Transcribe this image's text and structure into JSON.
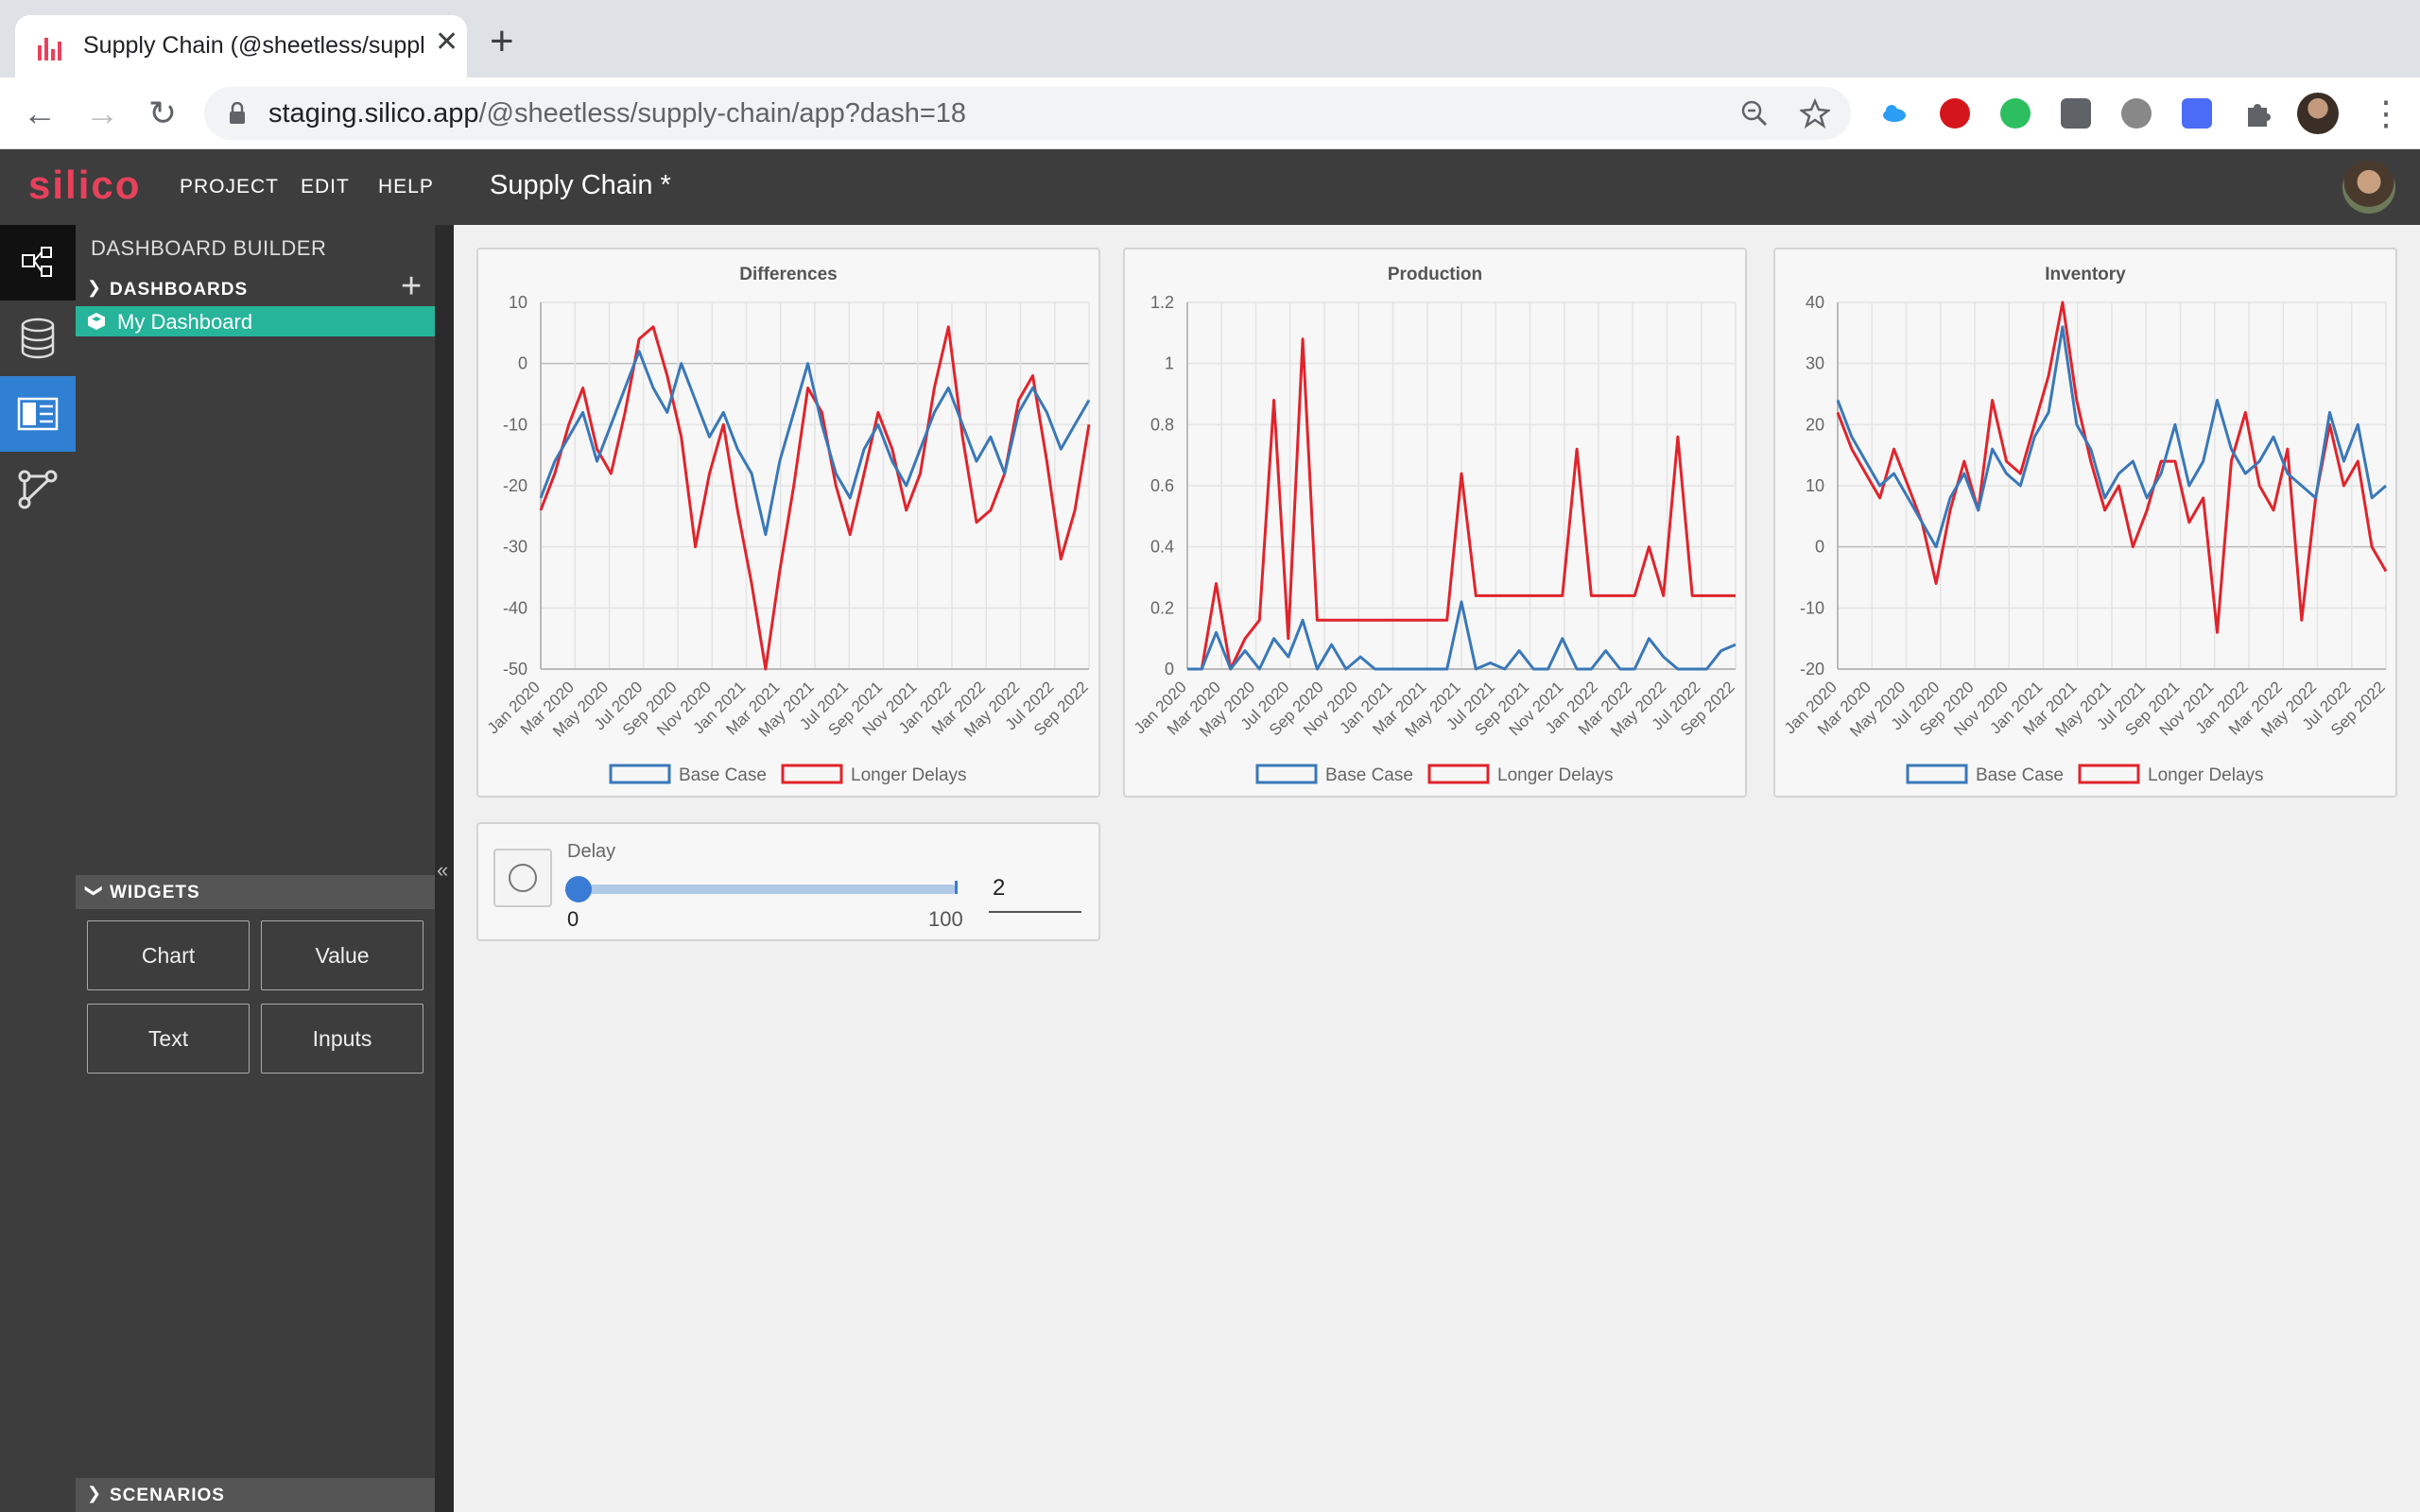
{
  "browser": {
    "tab_title": "Supply Chain (@sheetless/supply-chain",
    "url_host": "staging.silico.app",
    "url_path": "/@sheetless/supply-chain/app?dash=18"
  },
  "app": {
    "logo": "silico",
    "menu": [
      "PROJECT",
      "EDIT",
      "HELP"
    ],
    "doc_title": "Supply Chain *"
  },
  "sidebar": {
    "title": "DASHBOARD BUILDER",
    "dashboards_label": "DASHBOARDS",
    "dashboard_item": "My Dashboard",
    "widgets_label": "WIDGETS",
    "widgets": [
      "Chart",
      "Value",
      "Text",
      "Inputs"
    ],
    "scenarios_label": "SCENARIOS"
  },
  "slider": {
    "label": "Delay",
    "min": "0",
    "max": "100",
    "value": "2"
  },
  "colors": {
    "base": "#3a78b8",
    "longer": "#e0242c",
    "accent": "#26b49b",
    "logo": "#e8415c"
  },
  "chart_data": [
    {
      "type": "line",
      "title": "Differences",
      "x_ticks": [
        "Jan 2020",
        "Mar 2020",
        "May 2020",
        "Jul 2020",
        "Sep 2020",
        "Nov 2020",
        "Jan 2021",
        "Mar 2021",
        "May 2021",
        "Jul 2021",
        "Sep 2021",
        "Nov 2021",
        "Jan 2022",
        "Mar 2022",
        "May 2022",
        "Jul 2022",
        "Sep 2022"
      ],
      "ylim": [
        -50,
        10
      ],
      "y_ticks": [
        "10",
        "0",
        "-10",
        "-20",
        "-30",
        "-40",
        "-50"
      ],
      "series": [
        {
          "name": "Base Case",
          "values": [
            -22,
            -16,
            -12,
            -8,
            -16,
            -10,
            -4,
            2,
            -4,
            -8,
            0,
            -6,
            -12,
            -8,
            -14,
            -18,
            -28,
            -16,
            -8,
            0,
            -10,
            -18,
            -22,
            -14,
            -10,
            -16,
            -20,
            -14,
            -8,
            -4,
            -10,
            -16,
            -12,
            -18,
            -8,
            -4,
            -8,
            -14,
            -10,
            -6
          ]
        },
        {
          "name": "Longer Delays",
          "values": [
            -24,
            -18,
            -10,
            -4,
            -14,
            -18,
            -8,
            4,
            6,
            -2,
            -12,
            -30,
            -18,
            -10,
            -24,
            -36,
            -50,
            -34,
            -20,
            -4,
            -8,
            -20,
            -28,
            -18,
            -8,
            -14,
            -24,
            -18,
            -4,
            6,
            -12,
            -26,
            -24,
            -18,
            -6,
            -2,
            -16,
            -32,
            -24,
            -10
          ]
        }
      ],
      "legend": "bottom"
    },
    {
      "type": "line",
      "title": "Production",
      "x_ticks": [
        "Jan 2020",
        "Mar 2020",
        "May 2020",
        "Jul 2020",
        "Sep 2020",
        "Nov 2020",
        "Jan 2021",
        "Mar 2021",
        "May 2021",
        "Jul 2021",
        "Sep 2021",
        "Nov 2021",
        "Jan 2022",
        "Mar 2022",
        "May 2022",
        "Jul 2022",
        "Sep 2022"
      ],
      "ylim": [
        0,
        1.2
      ],
      "y_ticks": [
        "1.2",
        "1",
        "0.8",
        "0.6",
        "0.4",
        "0.2",
        "0"
      ],
      "series": [
        {
          "name": "Base Case",
          "values": [
            0,
            0,
            0.12,
            0,
            0.06,
            0,
            0.1,
            0.04,
            0.16,
            0,
            0.08,
            0,
            0.04,
            0,
            0,
            0,
            0,
            0,
            0,
            0.22,
            0,
            0.02,
            0,
            0.06,
            0,
            0,
            0.1,
            0,
            0,
            0.06,
            0,
            0,
            0.1,
            0.04,
            0,
            0,
            0,
            0.06,
            0.08
          ]
        },
        {
          "name": "Longer Delays",
          "values": [
            0,
            0,
            0.28,
            0,
            0.1,
            0.16,
            0.88,
            0.1,
            1.08,
            0.16,
            0.16,
            0.16,
            0.16,
            0.16,
            0.16,
            0.16,
            0.16,
            0.16,
            0.16,
            0.64,
            0.24,
            0.24,
            0.24,
            0.24,
            0.24,
            0.24,
            0.24,
            0.72,
            0.24,
            0.24,
            0.24,
            0.24,
            0.4,
            0.24,
            0.76,
            0.24,
            0.24,
            0.24,
            0.24
          ]
        }
      ],
      "legend": "bottom"
    },
    {
      "type": "line",
      "title": "Inventory",
      "x_ticks": [
        "Jan 2020",
        "Mar 2020",
        "May 2020",
        "Jul 2020",
        "Sep 2020",
        "Nov 2020",
        "Jan 2021",
        "Mar 2021",
        "May 2021",
        "Jul 2021",
        "Sep 2021",
        "Nov 2021",
        "Jan 2022",
        "Mar 2022",
        "May 2022",
        "Jul 2022",
        "Sep 2022"
      ],
      "ylim": [
        -20,
        40
      ],
      "y_ticks": [
        "40",
        "30",
        "20",
        "10",
        "0",
        "-10",
        "-20"
      ],
      "series": [
        {
          "name": "Base Case",
          "values": [
            24,
            18,
            14,
            10,
            12,
            8,
            4,
            0,
            8,
            12,
            6,
            16,
            12,
            10,
            18,
            22,
            36,
            20,
            16,
            8,
            12,
            14,
            8,
            12,
            20,
            10,
            14,
            24,
            16,
            12,
            14,
            18,
            12,
            10,
            8,
            22,
            14,
            20,
            8,
            10
          ]
        },
        {
          "name": "Longer Delays",
          "values": [
            22,
            16,
            12,
            8,
            16,
            10,
            4,
            -6,
            6,
            14,
            6,
            24,
            14,
            12,
            20,
            28,
            40,
            24,
            14,
            6,
            10,
            0,
            6,
            14,
            14,
            4,
            8,
            -14,
            14,
            22,
            10,
            6,
            16,
            -12,
            8,
            20,
            10,
            14,
            0,
            -4
          ]
        }
      ],
      "legend": "bottom"
    }
  ]
}
